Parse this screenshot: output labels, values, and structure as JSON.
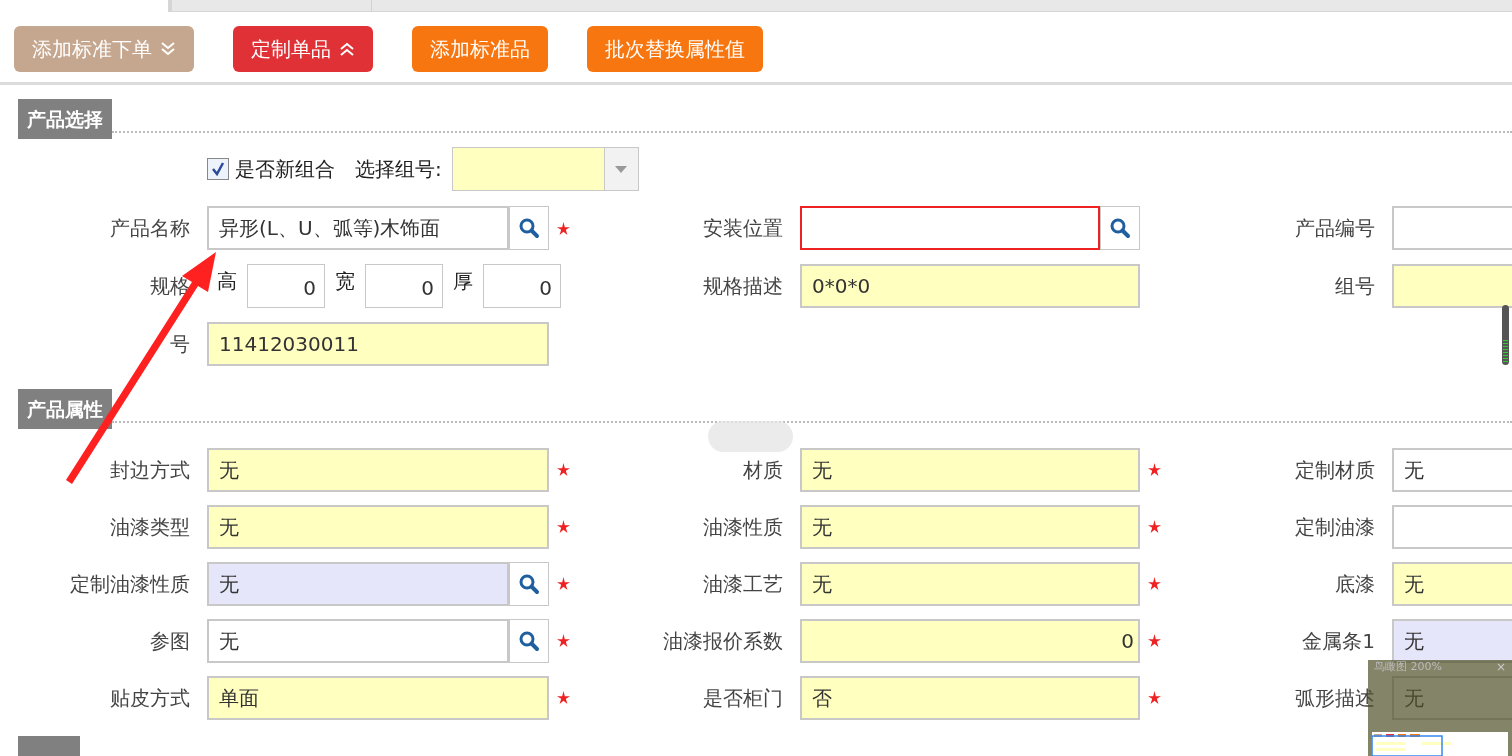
{
  "toolbar": {
    "buttons": [
      {
        "label": "添加标准下单",
        "color": "#c4a78e",
        "kind": "toggle",
        "expanded": false
      },
      {
        "label": "定制单品",
        "color": "#e03236",
        "kind": "toggle",
        "expanded": true
      },
      {
        "label": "添加标准品",
        "color": "#f7760f",
        "kind": "action"
      },
      {
        "label": "批次替换属性值",
        "color": "#f7760f",
        "kind": "action"
      }
    ]
  },
  "product_selection": {
    "title": "产品选择",
    "new_group": {
      "label": "是否新组合",
      "checked": true
    },
    "group_select": {
      "label": "选择组号:"
    },
    "rows": [
      [
        {
          "label": "产品名称",
          "kind": "lookup",
          "value": "异形(L、U、弧等)木饰面",
          "color": "#ffffff",
          "required": true,
          "invalid": false
        },
        {
          "label": "安装位置",
          "kind": "lookup",
          "required": false,
          "invalid": true
        },
        {
          "label": "产品编号",
          "kind": "text",
          "color": "#ffffff",
          "required": false,
          "invalid": false
        }
      ],
      [
        {
          "label": "规格",
          "kind": "dims",
          "parts": [
            {
              "label": "高",
              "value": "0"
            },
            {
              "label": "宽",
              "value": "0"
            },
            {
              "label": "厚",
              "value": "0"
            }
          ]
        },
        {
          "label": "规格描述",
          "kind": "text",
          "value": "0*0*0",
          "color": "#ffffc0",
          "required": false,
          "invalid": false
        },
        {
          "label": "组号",
          "kind": "text",
          "color": "#ffffc0",
          "required": false,
          "invalid": false
        }
      ],
      [
        {
          "label": "号",
          "kind": "text",
          "value": "11412030011",
          "color": "#ffffc0",
          "required": false,
          "invalid": false
        }
      ]
    ]
  },
  "product_attributes": {
    "title": "产品属性",
    "rows": [
      [
        {
          "label": "封边方式",
          "kind": "text",
          "value": "无",
          "color": "#ffffc0",
          "required": true,
          "invalid": false
        },
        {
          "label": "材质",
          "kind": "text",
          "value": "无",
          "color": "#ffffc0",
          "required": true,
          "invalid": false
        },
        {
          "label": "定制材质",
          "kind": "text",
          "value": "无",
          "color": "#ffffff",
          "required": false,
          "invalid": false
        }
      ],
      [
        {
          "label": "油漆类型",
          "kind": "text",
          "value": "无",
          "color": "#ffffc0",
          "required": true,
          "invalid": false
        },
        {
          "label": "油漆性质",
          "kind": "text",
          "value": "无",
          "color": "#ffffc0",
          "required": true,
          "invalid": false
        },
        {
          "label": "定制油漆",
          "kind": "text",
          "color": "#ffffff",
          "required": false,
          "invalid": false
        }
      ],
      [
        {
          "label": "定制油漆性质",
          "kind": "lookup",
          "value": "无",
          "color": "#e6e6fa",
          "required": true,
          "invalid": false
        },
        {
          "label": "油漆工艺",
          "kind": "text",
          "value": "无",
          "color": "#ffffc0",
          "required": true,
          "invalid": false
        },
        {
          "label": "底漆",
          "kind": "text",
          "value": "无",
          "color": "#ffffc0",
          "required": false,
          "invalid": false
        }
      ],
      [
        {
          "label": "参图",
          "kind": "lookup",
          "value": "无",
          "color": "#ffffff",
          "required": true,
          "invalid": false
        },
        {
          "label": "油漆报价系数",
          "kind": "numeric",
          "value": "0",
          "color": "#ffffc0",
          "required": true,
          "invalid": false
        },
        {
          "label": "金属条1",
          "kind": "text",
          "value": "无",
          "color": "#e6e6fa",
          "required": false,
          "invalid": false
        }
      ],
      [
        {
          "label": "贴皮方式",
          "kind": "text",
          "value": "单面",
          "color": "#ffffc0",
          "required": true,
          "invalid": false
        },
        {
          "label": "是否柜门",
          "kind": "text",
          "value": "否",
          "color": "#ffffc0",
          "required": true,
          "invalid": false
        },
        {
          "label": "弧形描述",
          "kind": "text",
          "value": "无",
          "required": false,
          "invalid": false
        }
      ]
    ]
  },
  "overview": {
    "title": "鸟瞰图 200%",
    "close": "×"
  }
}
